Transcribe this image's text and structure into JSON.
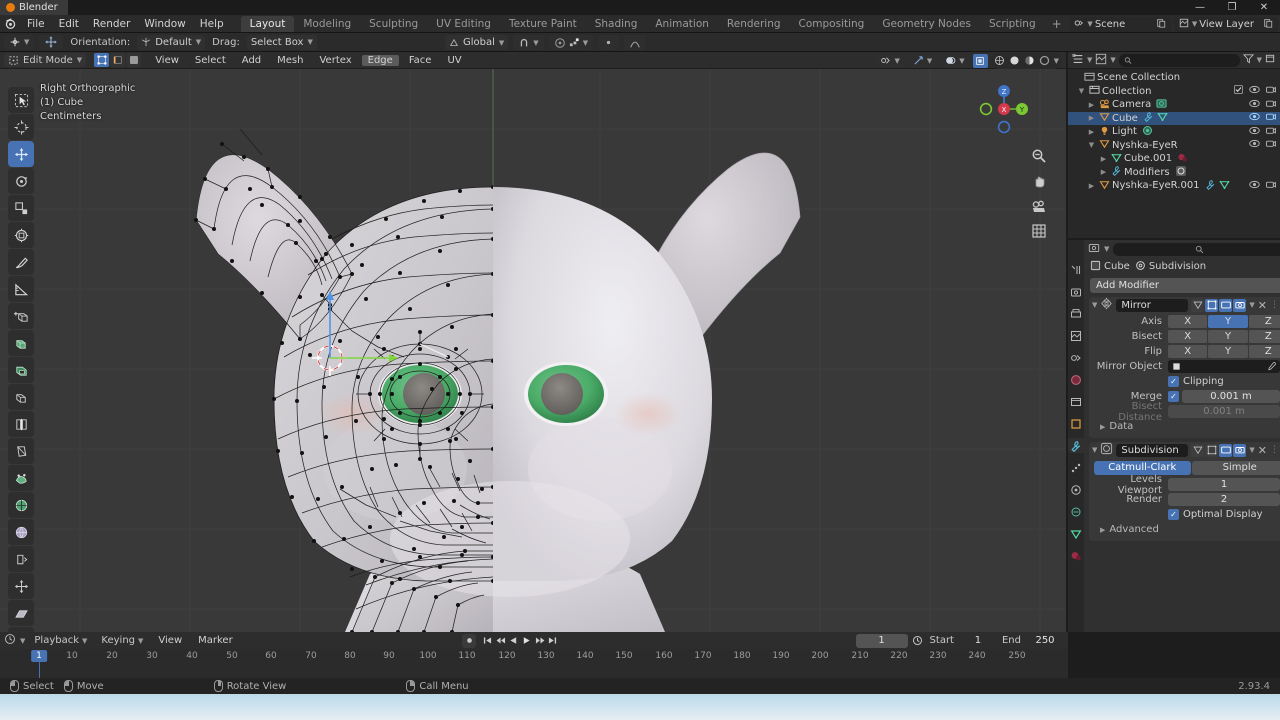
{
  "window": {
    "app_tab_title": "Blender",
    "controls": {
      "minimize": "—",
      "maximize": "❐",
      "close": "✕"
    }
  },
  "topbar": {
    "menus": [
      "File",
      "Edit",
      "Render",
      "Window",
      "Help"
    ],
    "workspaces": [
      {
        "label": "Layout",
        "active": true
      },
      {
        "label": "Modeling",
        "active": false
      },
      {
        "label": "Sculpting",
        "active": false
      },
      {
        "label": "UV Editing",
        "active": false
      },
      {
        "label": "Texture Paint",
        "active": false
      },
      {
        "label": "Shading",
        "active": false
      },
      {
        "label": "Animation",
        "active": false
      },
      {
        "label": "Rendering",
        "active": false
      },
      {
        "label": "Compositing",
        "active": false
      },
      {
        "label": "Geometry Nodes",
        "active": false
      },
      {
        "label": "Scripting",
        "active": false
      }
    ],
    "add_workspace": "+",
    "scene": {
      "label": "Scene",
      "icon": "scene-icon"
    },
    "view_layer": {
      "label": "View Layer",
      "icon": "view-layer-icon"
    }
  },
  "tool_settings": {
    "orientation_label": "Orientation:",
    "orientation_value": "Default",
    "drag_label": "Drag:",
    "drag_value": "Select Box",
    "transform_orientation": "Global",
    "snap_icon": "magnet-icon",
    "proportional_icon": "proportional-edit-icon"
  },
  "viewport": {
    "header": {
      "mode": "Edit Mode",
      "select_modes": [
        {
          "name": "vertex-select",
          "active": true
        },
        {
          "name": "edge-select",
          "active": false
        },
        {
          "name": "face-select",
          "active": false
        }
      ],
      "menus": [
        "View",
        "Select",
        "Add",
        "Mesh",
        "Vertex",
        "Edge",
        "Face",
        "UV"
      ],
      "active_menu": "Edge"
    },
    "overlay_text": {
      "view": "Right Orthographic",
      "object": "(1) Cube",
      "units": "Centimeters"
    },
    "gizmo_axes": [
      "X",
      "Y",
      "Z"
    ],
    "nav_buttons": [
      "zoom-icon",
      "pan-icon",
      "camera-icon",
      "grid-icon"
    ],
    "tools": [
      {
        "name": "tweak-tool",
        "active": false
      },
      {
        "name": "select-cursor-tool",
        "active": false
      },
      {
        "name": "move-tool",
        "active": true
      },
      {
        "name": "rotate-tool",
        "active": false
      },
      {
        "name": "scale-tool",
        "active": false
      },
      {
        "name": "transform-tool",
        "active": false
      },
      {
        "name": "annotate-tool",
        "active": false
      },
      {
        "name": "measure-tool",
        "active": false
      },
      {
        "name": "add-cube-tool",
        "active": false
      },
      {
        "name": "extrude-region-tool",
        "active": false
      },
      {
        "name": "inset-faces-tool",
        "active": false
      },
      {
        "name": "bevel-tool",
        "active": false
      },
      {
        "name": "loop-cut-tool",
        "active": false
      },
      {
        "name": "knife-tool",
        "active": false
      },
      {
        "name": "poly-build-tool",
        "active": false
      },
      {
        "name": "spin-tool",
        "active": false
      },
      {
        "name": "smooth-tool",
        "active": false
      },
      {
        "name": "edge-slide-tool",
        "active": false
      },
      {
        "name": "shrink-fatten-tool",
        "active": false
      },
      {
        "name": "shear-tool",
        "active": false
      },
      {
        "name": "rip-region-tool",
        "active": false
      }
    ]
  },
  "outliner": {
    "search_placeholder": "",
    "rows": [
      {
        "label": "Scene Collection",
        "indent": 0,
        "icon": "collection-icon",
        "disclosure": "",
        "selected": false,
        "eye": false,
        "camera": false,
        "checkbox": false,
        "badges": []
      },
      {
        "label": "Collection",
        "indent": 1,
        "icon": "collection-icon",
        "disclosure": "▼",
        "selected": false,
        "eye": true,
        "camera": true,
        "checkbox": true,
        "badges": []
      },
      {
        "label": "Camera",
        "indent": 2,
        "icon": "camera-obj-icon",
        "disclosure": "▶",
        "selected": false,
        "eye": true,
        "camera": true,
        "checkbox": false,
        "badges": [
          "camera-data-icon"
        ]
      },
      {
        "label": "Cube",
        "indent": 2,
        "icon": "mesh-icon",
        "disclosure": "▶",
        "selected": true,
        "eye": true,
        "camera": true,
        "checkbox": false,
        "badges": [
          "modifier-icon",
          "mesh-data-icon"
        ]
      },
      {
        "label": "Light",
        "indent": 2,
        "icon": "light-obj-icon",
        "disclosure": "▶",
        "selected": false,
        "eye": true,
        "camera": true,
        "checkbox": false,
        "badges": [
          "light-data-icon"
        ]
      },
      {
        "label": "Nyshka-EyeR",
        "indent": 2,
        "icon": "mesh-icon",
        "disclosure": "▼",
        "selected": false,
        "eye": true,
        "camera": true,
        "checkbox": false,
        "badges": []
      },
      {
        "label": "Cube.001",
        "indent": 3,
        "icon": "mesh-data-icon",
        "disclosure": "▶",
        "selected": false,
        "eye": false,
        "camera": false,
        "checkbox": false,
        "badges": [
          "material-icon"
        ]
      },
      {
        "label": "Modifiers",
        "indent": 3,
        "icon": "modifier-icon",
        "disclosure": "▶",
        "selected": false,
        "eye": false,
        "camera": false,
        "checkbox": false,
        "badges": [
          "mirror-mod-icon"
        ]
      },
      {
        "label": "Nyshka-EyeR.001",
        "indent": 2,
        "icon": "mesh-icon",
        "disclosure": "▶",
        "selected": false,
        "eye": true,
        "camera": true,
        "checkbox": false,
        "badges": [
          "modifier-icon",
          "mesh-data-icon"
        ]
      }
    ]
  },
  "properties": {
    "breadcrumb": [
      {
        "label": "Cube",
        "icon": "object-icon"
      },
      {
        "label": "Subdivision",
        "icon": "modifier-icon"
      }
    ],
    "add_modifier_label": "Add Modifier",
    "modifiers": [
      {
        "name": "Mirror",
        "icon": "mirror-icon",
        "expanded": true,
        "display_toggles": [
          {
            "name": "on-cage",
            "active": false
          },
          {
            "name": "edit-mode-display",
            "active": true
          },
          {
            "name": "realtime-display",
            "active": true
          },
          {
            "name": "render-display",
            "active": true
          }
        ],
        "rows": [
          {
            "type": "segmented",
            "label": "Axis",
            "options": [
              "X",
              "Y",
              "Z"
            ],
            "active": [
              "Y"
            ]
          },
          {
            "type": "segmented",
            "label": "Bisect",
            "options": [
              "X",
              "Y",
              "Z"
            ],
            "active": []
          },
          {
            "type": "segmented",
            "label": "Flip",
            "options": [
              "X",
              "Y",
              "Z"
            ],
            "active": []
          },
          {
            "type": "object",
            "label": "Mirror Object",
            "value": ""
          },
          {
            "type": "checkbox",
            "label": "",
            "text": "Clipping",
            "checked": true
          },
          {
            "type": "checkfield",
            "label": "Merge",
            "checked": true,
            "value": "0.001 m",
            "dim": false
          },
          {
            "type": "field",
            "label": "Bisect Distance",
            "value": "0.001 m",
            "dim": true
          }
        ],
        "subpanels": [
          "Data"
        ]
      },
      {
        "name": "Subdivision",
        "icon": "subdivision-icon",
        "expanded": true,
        "display_toggles": [
          {
            "name": "on-cage",
            "active": false
          },
          {
            "name": "edit-mode-display",
            "active": false
          },
          {
            "name": "realtime-display",
            "active": true
          },
          {
            "name": "render-display",
            "active": true
          }
        ],
        "algorithm": {
          "options": [
            "Catmull-Clark",
            "Simple"
          ],
          "active": "Catmull-Clark"
        },
        "rows": [
          {
            "type": "field",
            "label": "Levels Viewport",
            "value": "1",
            "dim": false
          },
          {
            "type": "field",
            "label": "Render",
            "value": "2",
            "dim": false
          },
          {
            "type": "checkbox",
            "label": "",
            "text": "Optimal Display",
            "checked": true
          }
        ],
        "subpanels": [
          "Advanced"
        ]
      }
    ]
  },
  "timeline": {
    "menus": [
      "View",
      "Marker"
    ],
    "dropdowns": [
      "Playback",
      "Keying"
    ],
    "current_frame": "1",
    "start_label": "Start",
    "start_value": "1",
    "end_label": "End",
    "end_value": "250",
    "playhead_frame": "1",
    "ticks": [
      "10",
      "20",
      "30",
      "40",
      "50",
      "60",
      "70",
      "80",
      "90",
      "100",
      "110",
      "120",
      "130",
      "140",
      "150",
      "160",
      "170",
      "180",
      "190",
      "200",
      "210",
      "220",
      "230",
      "240",
      "250"
    ]
  },
  "statusbar": {
    "hints": [
      {
        "mouse": "l",
        "label": "Select"
      },
      {
        "mouse": "l",
        "label": "Move"
      },
      {
        "mouse": "m",
        "label": "Rotate View"
      },
      {
        "mouse": "r",
        "label": "Call Menu"
      }
    ],
    "version": "2.93.4"
  },
  "colors": {
    "accent": "#4772b3",
    "selected_row": "#32527e",
    "orange": "#e87d0d",
    "eye_green": "#4bab67",
    "bg_dark": "#1d1d1d",
    "panel": "#303030",
    "viewport": "#393939"
  }
}
